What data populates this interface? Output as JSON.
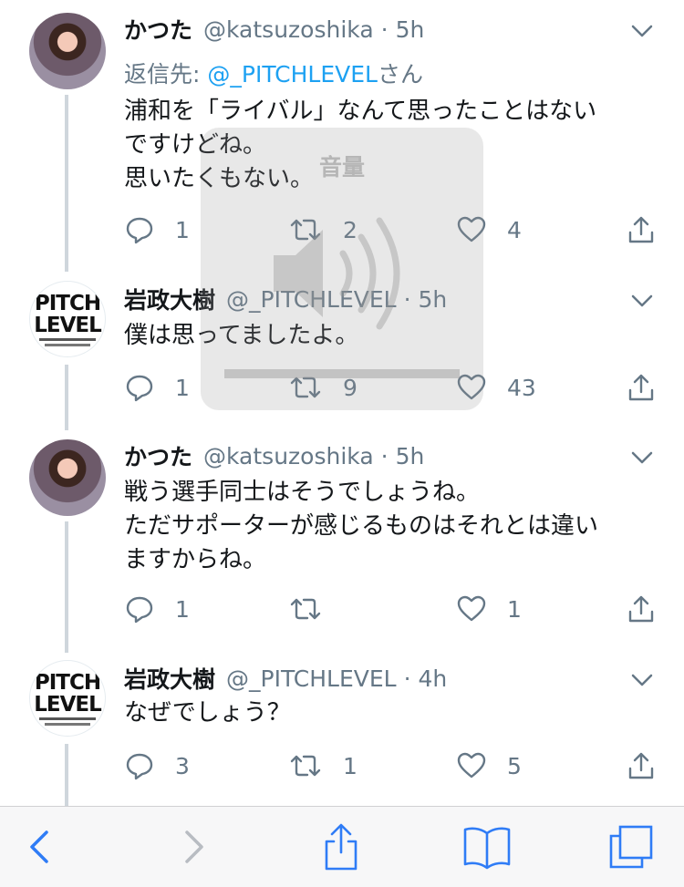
{
  "tweets": [
    {
      "name": "かつた",
      "handle": "@katsuzoshika",
      "sep": "·",
      "time": "5h",
      "reply_prefix": "返信先: ",
      "reply_mention": "@_PITCHLEVEL",
      "reply_suffix": "さん",
      "lines": [
        "浦和を「ライバル」なんて思ったことはない",
        "ですけどね。",
        "思いたくもない。"
      ],
      "replies": "1",
      "retweets": "2",
      "likes": "4",
      "avatar": "user-photo"
    },
    {
      "name": "岩政大樹",
      "handle": "@_PITCHLEVEL",
      "sep": "·",
      "time": "5h",
      "lines": [
        "僕は思ってましたよ。"
      ],
      "replies": "1",
      "retweets": "9",
      "likes": "43",
      "avatar": "book-cover",
      "avatar_text": [
        "PITCH",
        "LEVEL"
      ]
    },
    {
      "name": "かつた",
      "handle": "@katsuzoshika",
      "sep": "·",
      "time": "5h",
      "lines": [
        "戦う選手同士はそうでしょうね。",
        "ただサポーターが感じるものはそれとは違い",
        "ますからね。"
      ],
      "replies": "1",
      "retweets": "",
      "likes": "1",
      "avatar": "user-photo"
    },
    {
      "name": "岩政大樹",
      "handle": "@_PITCHLEVEL",
      "sep": "·",
      "time": "4h",
      "lines": [
        "なぜでしょう？"
      ],
      "replies": "3",
      "retweets": "1",
      "likes": "5",
      "avatar": "book-cover",
      "avatar_text": [
        "PITCH",
        "LEVEL"
      ]
    }
  ],
  "volume_hud": {
    "title": "音量",
    "icon": "speaker-icon"
  },
  "toolbar": {
    "items": [
      "back-icon",
      "forward-icon",
      "share-icon",
      "bookmarks-icon",
      "tabs-icon"
    ]
  },
  "colors": {
    "accent": "#1da1f2",
    "secondary_text": "#657786",
    "thread_line": "#cfd6dc",
    "safari_blue": "#2f7cf6"
  }
}
